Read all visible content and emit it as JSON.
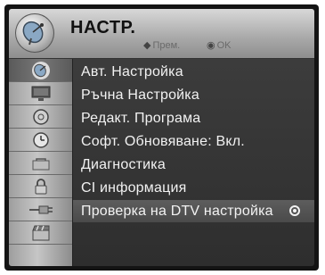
{
  "header": {
    "title": "НАСТР.",
    "move_hint": "Прем.",
    "ok_hint": "OK",
    "icon": "satellite-dish-icon"
  },
  "sidebar": {
    "icons": [
      "satellite-dish-icon",
      "monitor-icon",
      "settings-dial-icon",
      "clock-icon",
      "lock-icon",
      "padlock-icon",
      "input-plug-icon",
      "media-clapper-icon"
    ]
  },
  "menu": {
    "items": [
      {
        "label": "Авт. Настройка"
      },
      {
        "label": "Ръчна Настройка"
      },
      {
        "label": "Редакт. Програма"
      },
      {
        "label": "Софт. Обновяване: Вкл."
      },
      {
        "label": "Диагностика"
      },
      {
        "label": "CI информация"
      },
      {
        "label": "Проверка на DTV настройка"
      }
    ],
    "selected_index": 6
  },
  "colors": {
    "panel_bg": "#3a3a3a",
    "text": "#f2f2f2",
    "header_bg": "#b8b8b8"
  }
}
